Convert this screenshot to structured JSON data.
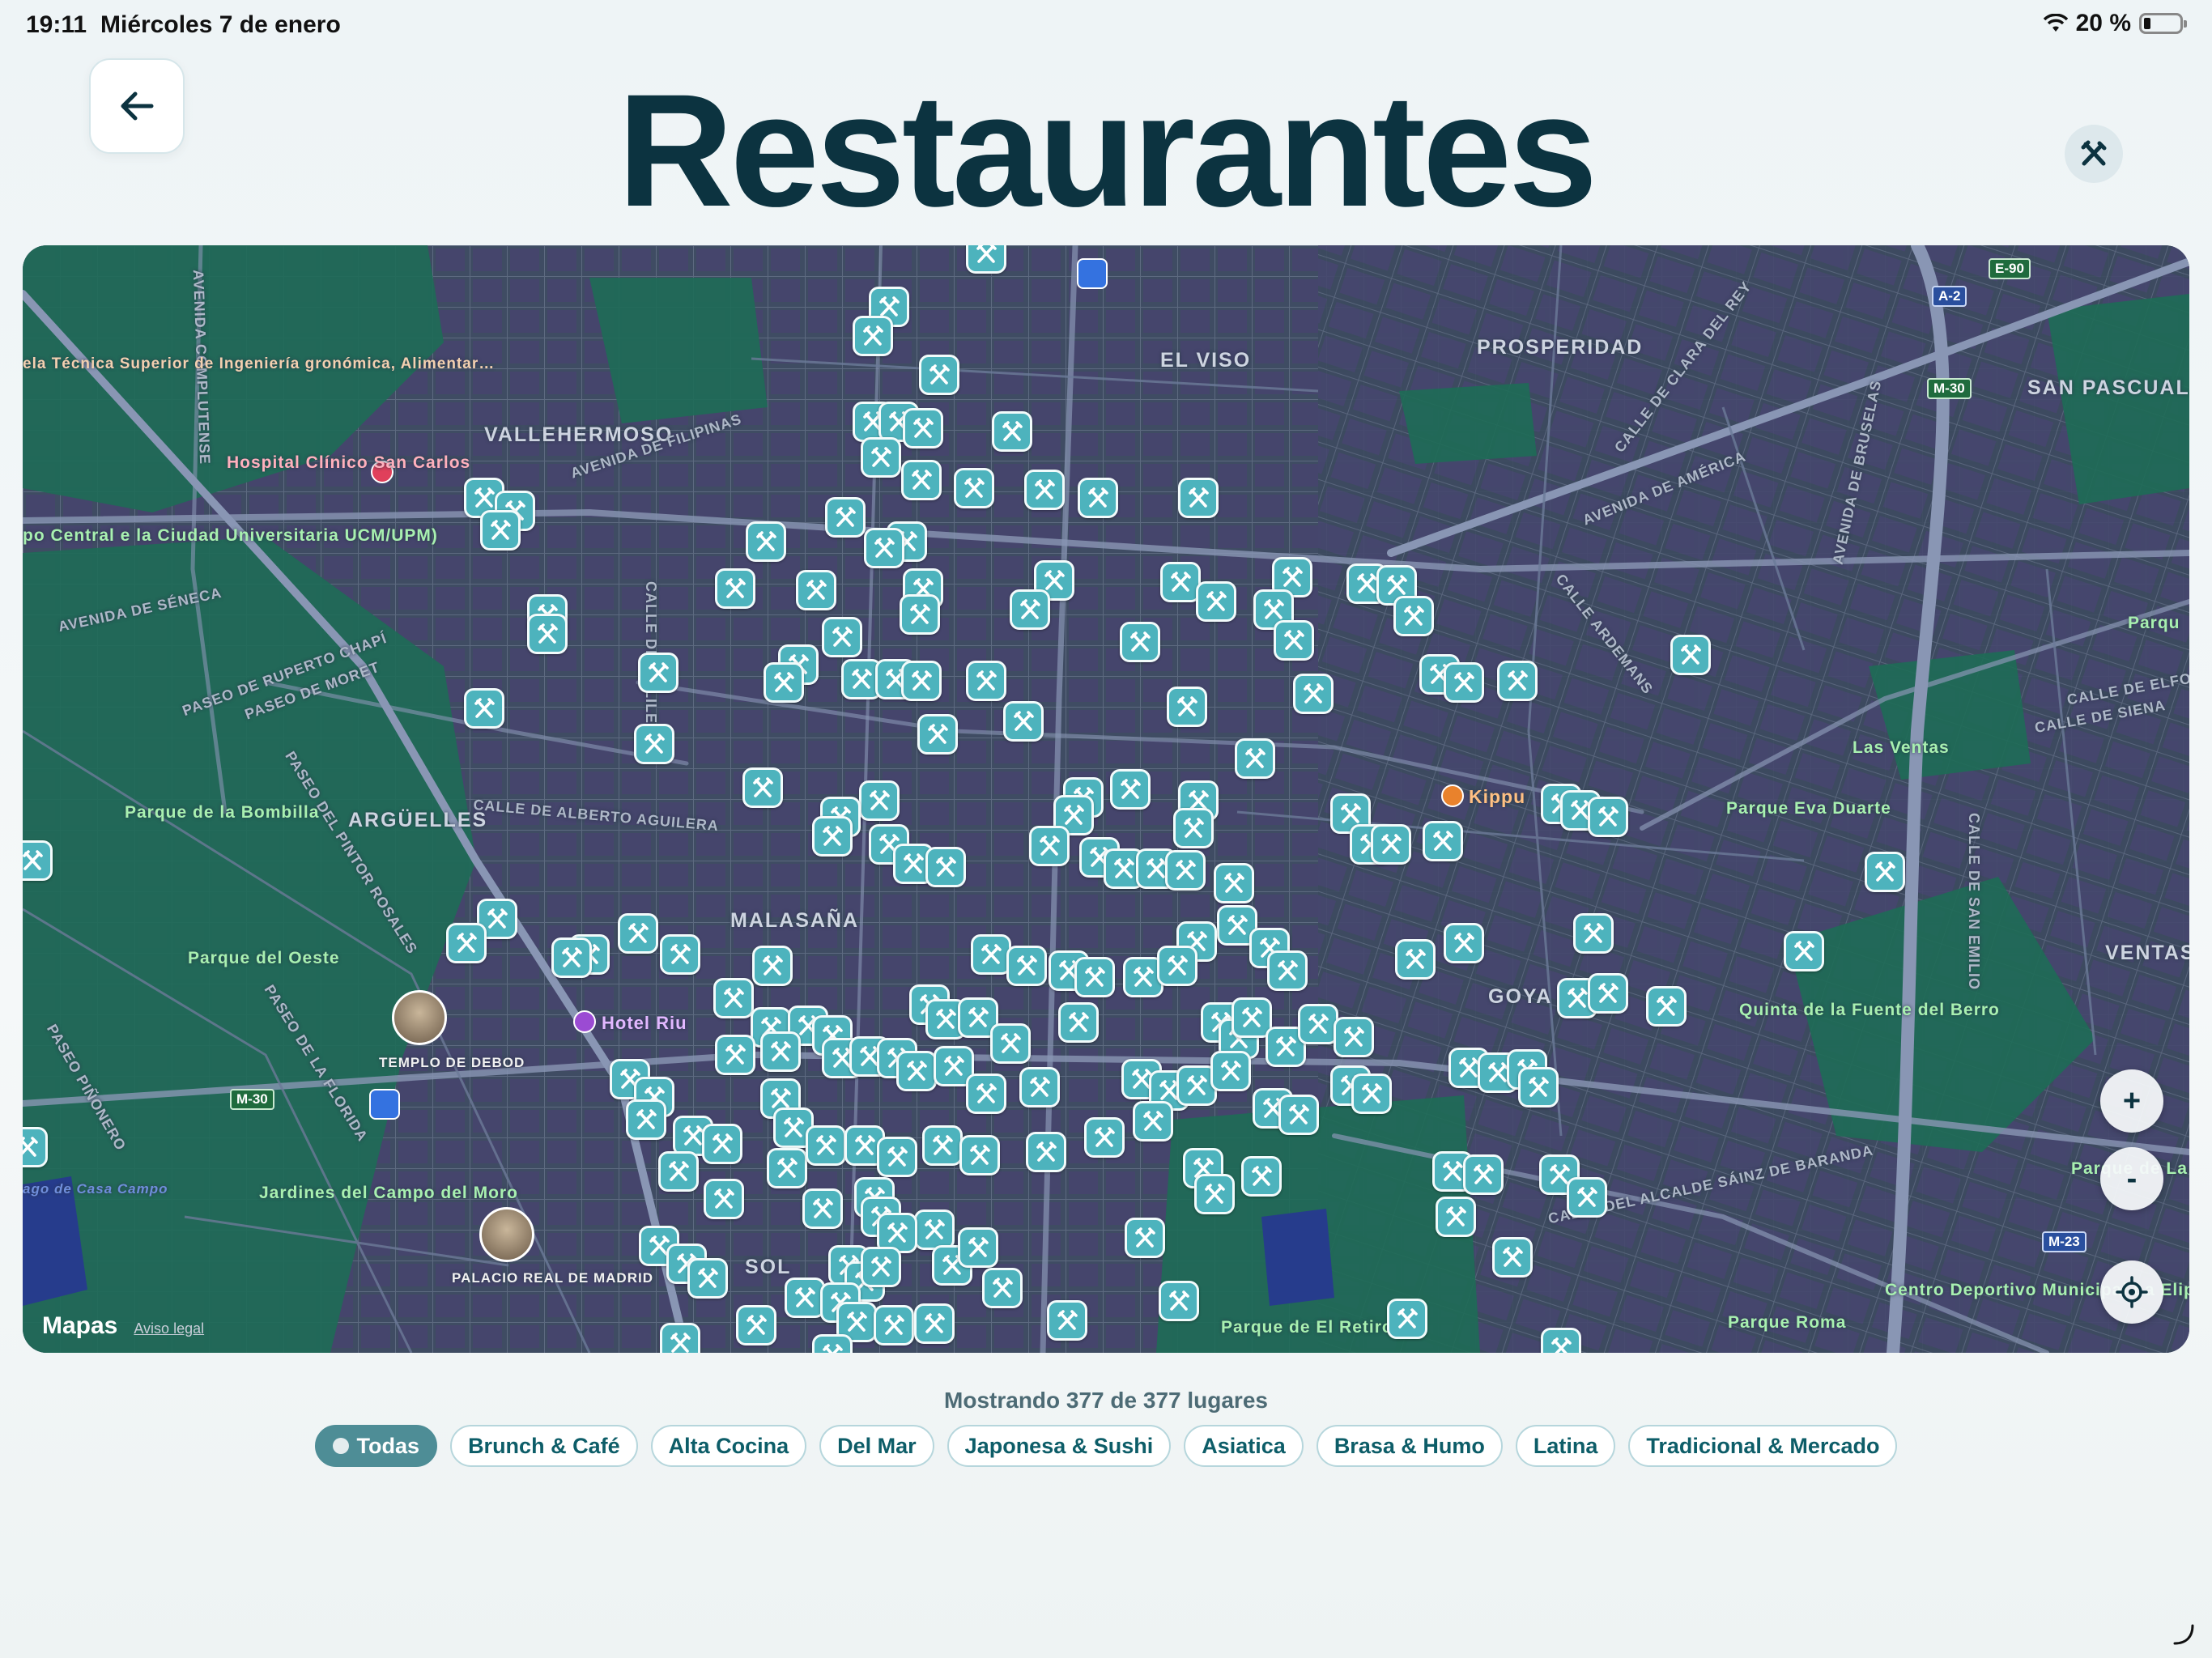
{
  "status_bar": {
    "time": "19:11",
    "date": "Miércoles 7 de enero",
    "battery": "20 %"
  },
  "header": {
    "title": "Restaurantes",
    "back_icon": "arrow-left-icon",
    "category_icon": "fork-knife-icon"
  },
  "map": {
    "districts": [
      "EL VISO",
      "PROSPERIDAD",
      "SAN PASCUAL",
      "VALLEHERMOSO",
      "ARGÜELLES",
      "MALASAÑA",
      "GOYA",
      "VENTAS",
      "SOL"
    ],
    "streets": [
      "AVENIDA DE FILIPINAS",
      "AVENIDA DE SÉNECA",
      "PASEO DE RUPERTO CHAPÍ",
      "PASEO DE MORET",
      "CALLE DE ALBERTO AGUILERA",
      "CALLE DE GALILEO",
      "PASEO DEL PINTOR ROSALES",
      "PASEO DE LA FLORIDA",
      "PASEO PIÑONERO",
      "AVENIDA DE AMÉRICA",
      "CALLE DE CLARA DEL REY",
      "AVENIDA DE BRUSELAS",
      "CALLE ARDEMANS",
      "CALLE DE ELFO",
      "CALLE DE SIENA",
      "CALLE DE SAN EMILIO",
      "CALLE DEL ALCALDE SÁINZ DE BARANDA",
      "AVENIDA COMPLUTENSE"
    ],
    "pois": {
      "hospital": "Hospital Clínico San Carlos",
      "ag_school": "ela Técnica Superior de Ingeniería gronómica, Alimentar…",
      "campus": "po Central e la Ciudad Universitaria UCM/UPM)",
      "parque_bombilla": "Parque de la Bombilla",
      "parque_oeste": "Parque del Oeste",
      "templo": "TEMPLO DE DEBOD",
      "hotel": "Hotel Riu",
      "jardines": "Jardines del Campo del Moro",
      "palacio": "PALACIO REAL DE MADRID",
      "kippu": "Kippu",
      "las_ventas": "Las Ventas",
      "parque_eva": "Parque Eva Duarte",
      "quinta": "Quinta de la Fuente del Berro",
      "parque_retiro": "Parque de El Retiro",
      "parque_roma": "Parque Roma",
      "centro_deportivo": "Centro Deportivo Municipal La Elipa",
      "parque_right": "Parqu",
      "parque_right2": "Parque de La Elip",
      "lago": "ago de Casa Campo"
    },
    "road_shields": [
      "E-90",
      "A-2",
      "M-30",
      "M-30",
      "M-23"
    ],
    "attribution": "Mapas",
    "legal": "Aviso legal",
    "zoom_in": "+",
    "zoom_out": "-",
    "locate_icon": "location-target-icon",
    "pin_icon": "fork-knife-icon"
  },
  "results": {
    "count_text": "Mostrando 377 de 377 lugares"
  },
  "filters": [
    {
      "label": "Todas",
      "active": true
    },
    {
      "label": "Brunch & Café",
      "active": false
    },
    {
      "label": "Alta Cocina",
      "active": false
    },
    {
      "label": "Del Mar",
      "active": false
    },
    {
      "label": "Japonesa & Sushi",
      "active": false
    },
    {
      "label": "Asiatica",
      "active": false
    },
    {
      "label": "Brasa & Humo",
      "active": false
    },
    {
      "label": "Latina",
      "active": false
    },
    {
      "label": "Tradicional & Mercado",
      "active": false
    }
  ],
  "colors": {
    "accent": "#4db3bd",
    "title": "#0c3340",
    "chip_active": "#4e8d96",
    "map_base": "#3d4a60"
  }
}
